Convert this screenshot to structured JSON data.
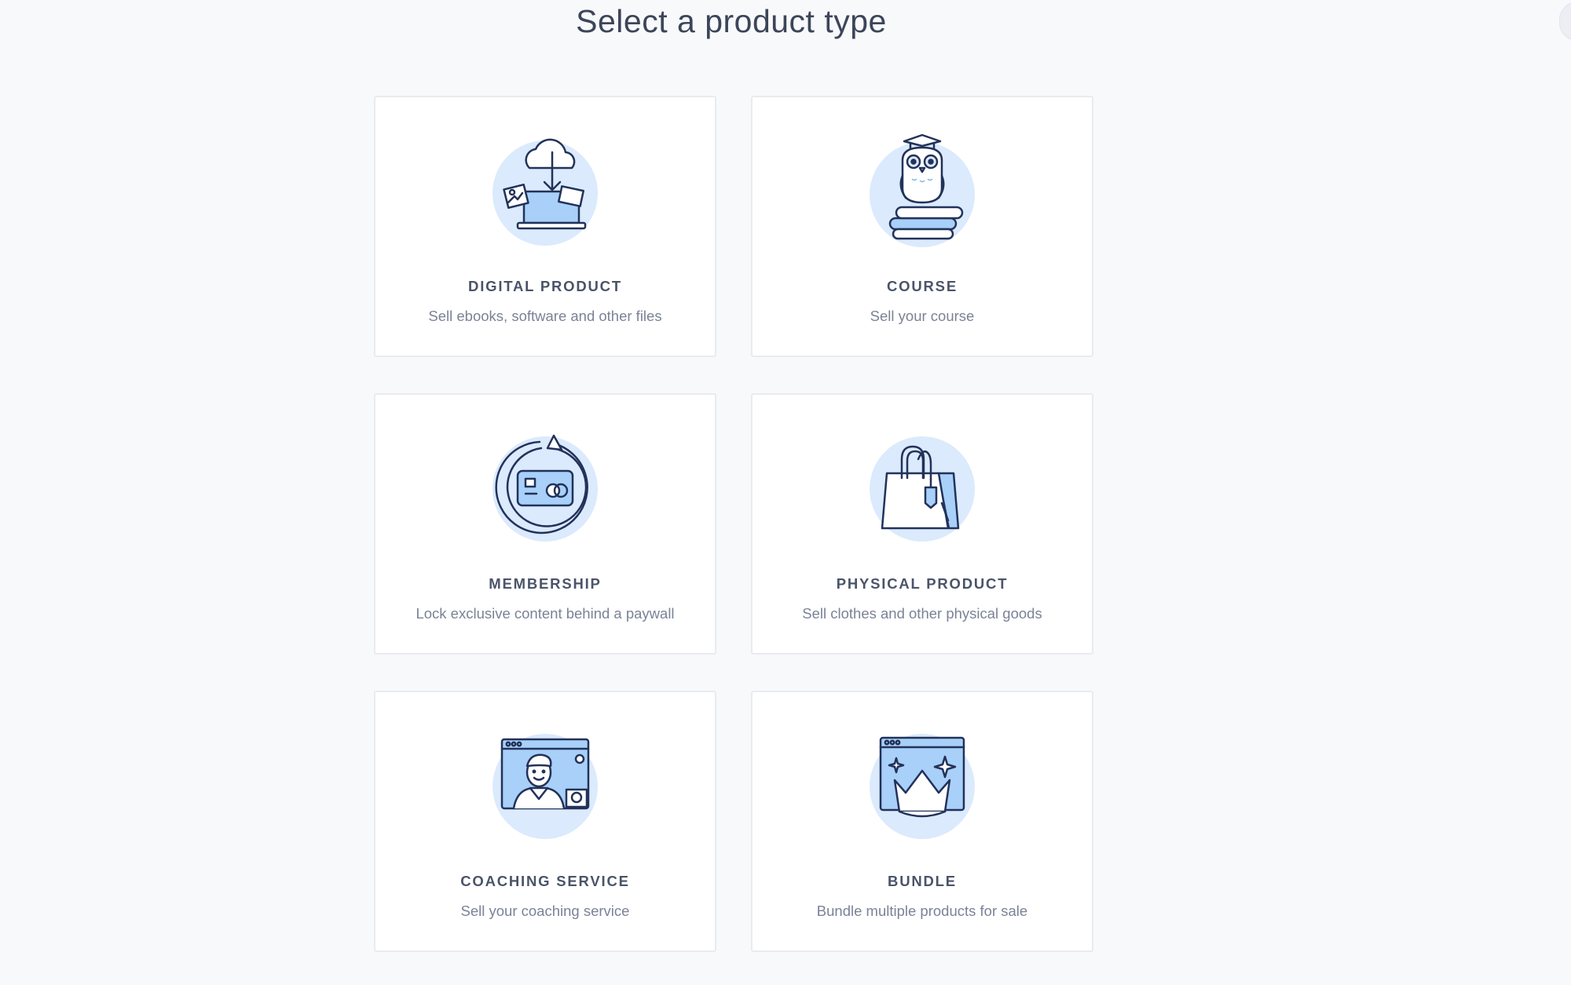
{
  "page": {
    "title": "Select a product type"
  },
  "colors": {
    "background": "#f8f9fb",
    "card": "#ffffff",
    "icon_circle": "#dbeafd",
    "icon_fill": "#a8d0f8",
    "icon_stroke": "#22325a"
  },
  "product_types": [
    {
      "title": "DIGITAL PRODUCT",
      "description": "Sell ebooks, software and other files",
      "icon": "cloud-download-laptop-icon"
    },
    {
      "title": "COURSE",
      "description": "Sell your course",
      "icon": "owl-books-icon"
    },
    {
      "title": "MEMBERSHIP",
      "description": "Lock exclusive content behind a paywall",
      "icon": "recurring-card-icon"
    },
    {
      "title": "PHYSICAL PRODUCT",
      "description": "Sell clothes and other physical goods",
      "icon": "shopping-bag-icon"
    },
    {
      "title": "COACHING SERVICE",
      "description": "Sell your coaching service",
      "icon": "video-call-icon"
    },
    {
      "title": "BUNDLE",
      "description": "Bundle multiple products for sale",
      "icon": "crown-window-icon"
    }
  ]
}
